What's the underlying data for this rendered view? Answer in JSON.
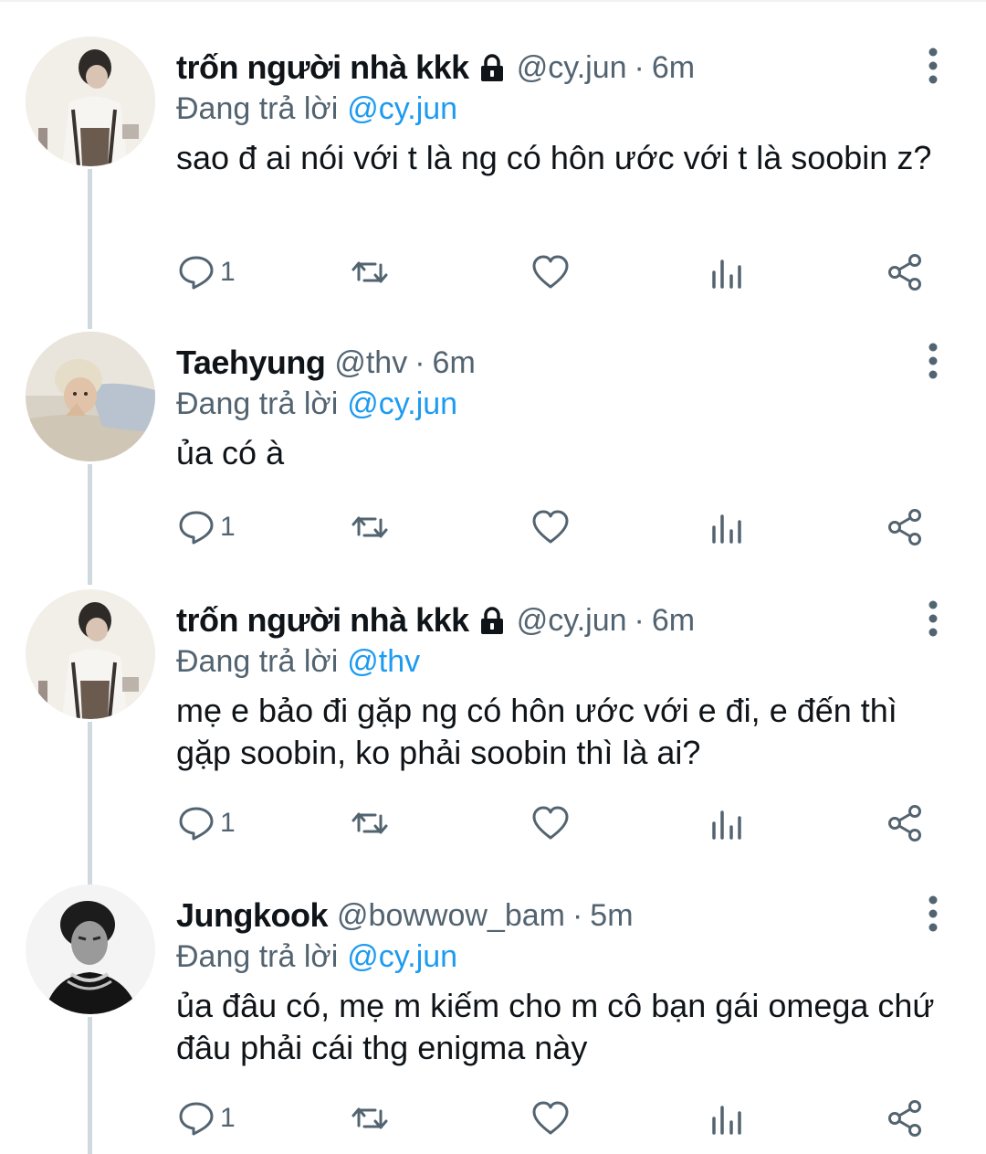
{
  "tweets": [
    {
      "display_name": "trốn người nhà kkk",
      "locked": true,
      "handle": "@cy.jun",
      "separator": "·",
      "time": "6m",
      "reply_prefix": "Đang trả lời",
      "reply_to": "@cy.jun",
      "text": "sao đ ai nói với t là ng có hôn ước với t là soobin z?",
      "reply_count": "1",
      "avatar": "avatar-boy-cooking"
    },
    {
      "display_name": "Taehyung",
      "locked": false,
      "handle": "@thv",
      "separator": "·",
      "time": "6m",
      "reply_prefix": "Đang trả lời",
      "reply_to": "@cy.jun",
      "text": "ủa có à",
      "reply_count": "1",
      "avatar": "avatar-blond-lying"
    },
    {
      "display_name": "trốn người nhà kkk",
      "locked": true,
      "handle": "@cy.jun",
      "separator": "·",
      "time": "6m",
      "reply_prefix": "Đang trả lời",
      "reply_to": "@thv",
      "text": "mẹ e bảo đi gặp ng có hôn ước với e đi, e đến thì gặp soobin, ko phải soobin thì là ai?",
      "reply_count": "1",
      "avatar": "avatar-boy-cooking"
    },
    {
      "display_name": "Jungkook",
      "locked": false,
      "handle": "@bowwow_bam",
      "separator": "·",
      "time": "5m",
      "reply_prefix": "Đang trả lời",
      "reply_to": "@cy.jun",
      "text": "ủa đâu có, mẹ m kiếm cho m cô bạn gái omega chứ đâu phải cái thg enigma này",
      "reply_count": "1",
      "avatar": "avatar-black-white-portrait"
    }
  ],
  "colors": {
    "secondary_text": "#536471",
    "mention": "#1d9bf0",
    "thread_line": "#cfd9de"
  },
  "icons": [
    "lock-icon",
    "more-vertical-icon",
    "reply-icon",
    "retweet-icon",
    "like-icon",
    "analytics-icon",
    "share-icon"
  ]
}
